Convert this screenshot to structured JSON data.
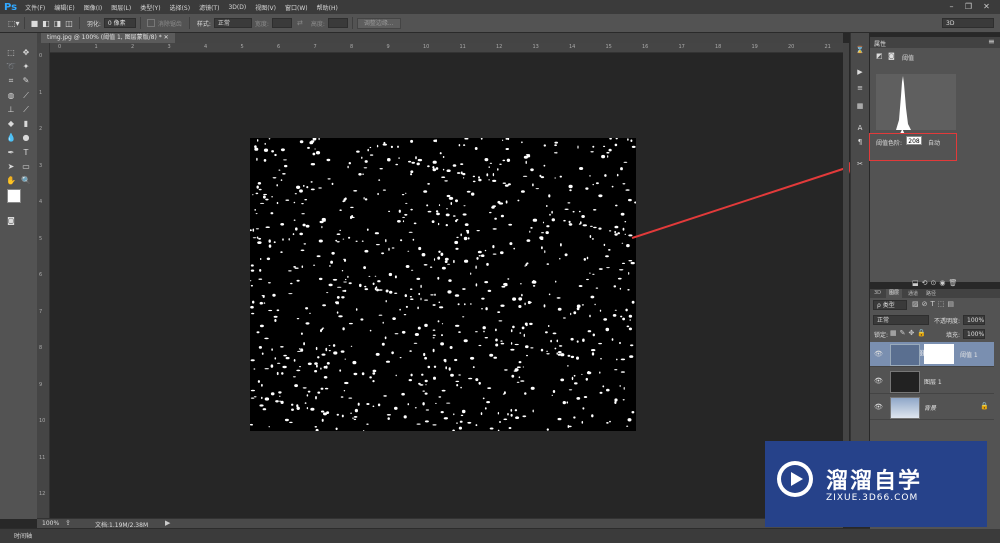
{
  "app": {
    "logo": "Ps"
  },
  "menu": [
    "文件(F)",
    "编辑(E)",
    "图像(I)",
    "图层(L)",
    "类型(Y)",
    "选择(S)",
    "滤镜(T)",
    "3D(D)",
    "视图(V)",
    "窗口(W)",
    "帮助(H)"
  ],
  "options": {
    "feather_label": "羽化:",
    "feather_value": "0 像素",
    "antialias_label": "消除锯齿",
    "style_label": "样式:",
    "style_value": "正常",
    "width_label": "宽度:",
    "height_label": "高度:",
    "refine_button": "调整边缘...",
    "workspace_value": "3D"
  },
  "document": {
    "tab_title": "timg.jpg @ 100% (阈值 1, 图层蒙版/8) *",
    "zoom": "100%",
    "doc_info": "文档:1.19M/2.38M"
  },
  "ruler_marks": [
    "0",
    "1",
    "2",
    "3",
    "4",
    "5",
    "6",
    "7",
    "8",
    "9",
    "10",
    "11",
    "12",
    "13",
    "14",
    "15",
    "16",
    "17",
    "18",
    "19",
    "20",
    "21"
  ],
  "properties": {
    "panel_title": "属性",
    "adjustment_name": "阈值",
    "threshold_label": "阈值色阶:",
    "threshold_value": "208",
    "auto_label": "自动"
  },
  "layers": {
    "tabs": [
      "3D",
      "图层",
      "通道",
      "路径"
    ],
    "kind_label": "ρ 类型",
    "blend_mode": "正常",
    "opacity_label": "不透明度:",
    "opacity_value": "100%",
    "lock_label": "锁定:",
    "fill_label": "填充:",
    "fill_value": "100%",
    "items": [
      {
        "name": "阈值 1"
      },
      {
        "name": "图层 1"
      },
      {
        "name": "背景"
      }
    ]
  },
  "timeline": {
    "label": "时间轴"
  },
  "watermark": {
    "title": "溜溜自学",
    "subtitle": "ZIXUE.3D66.COM"
  },
  "colors": {
    "accent": "#31a8ff",
    "annotation": "#e23a3a",
    "watermark_bg": "#26428a"
  }
}
